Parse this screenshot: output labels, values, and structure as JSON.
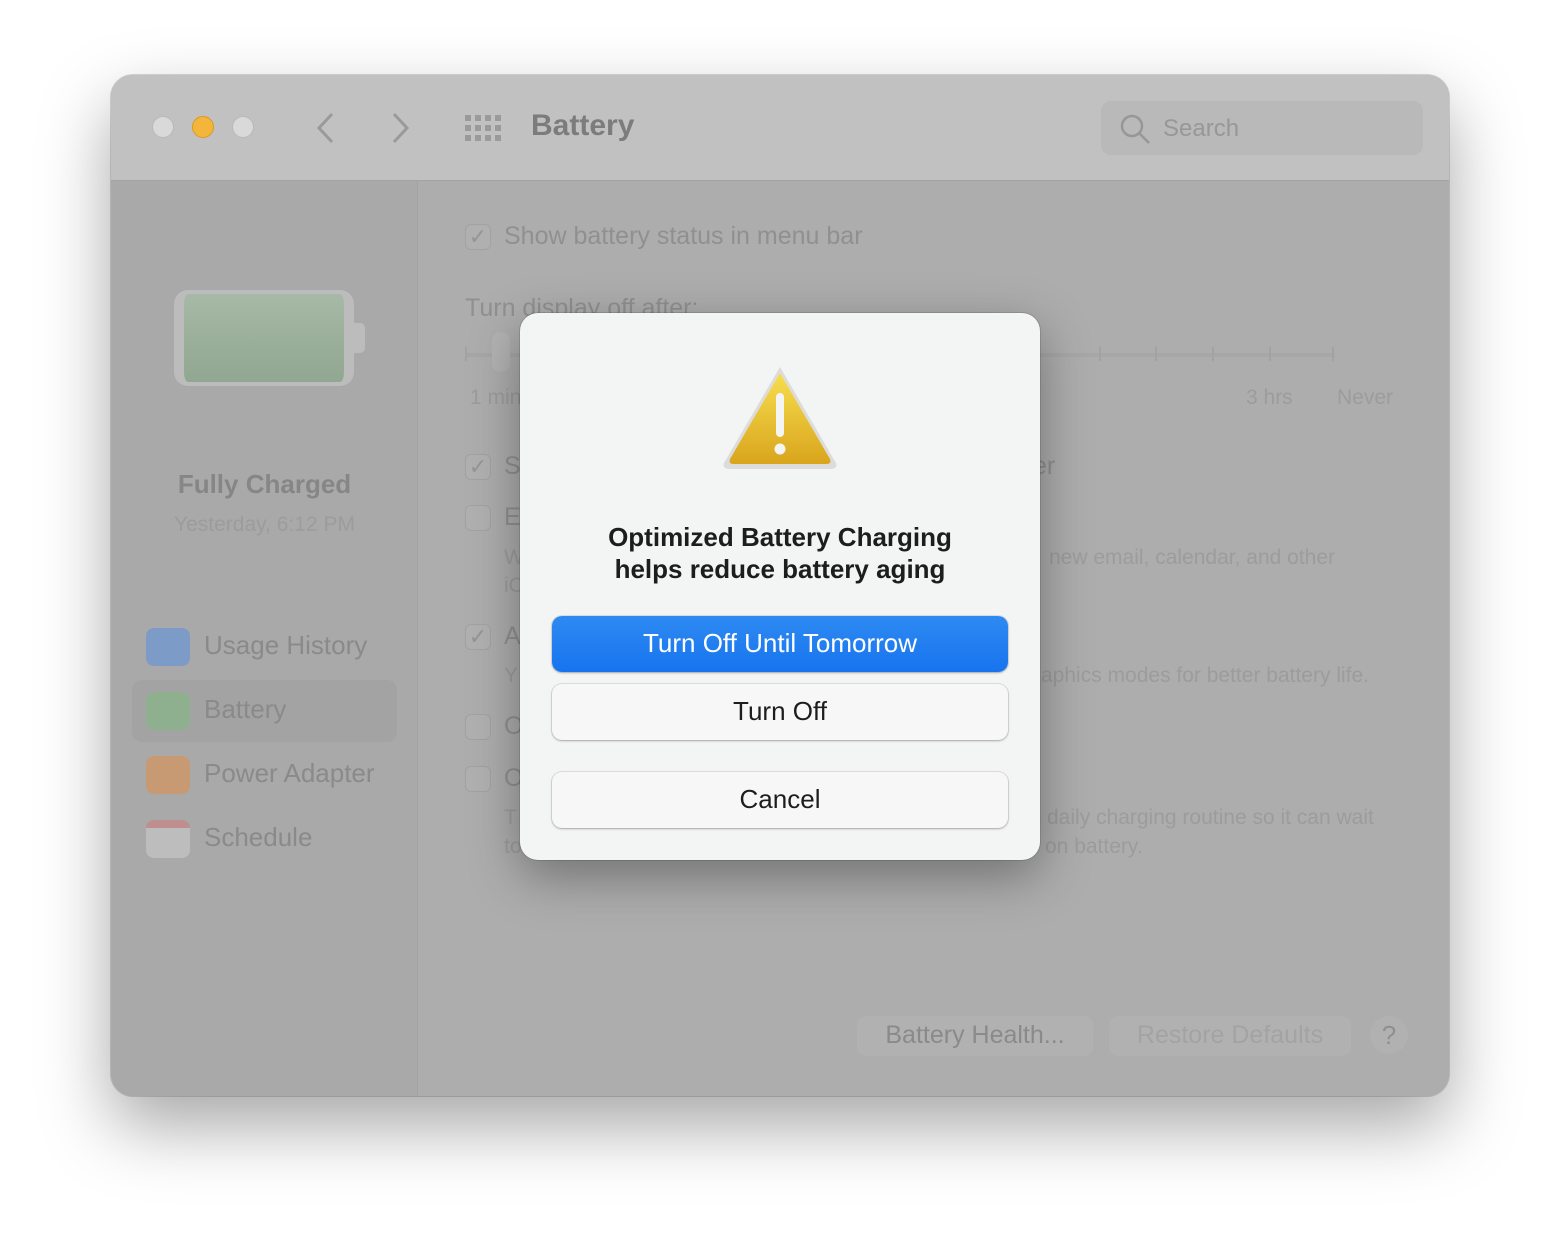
{
  "window": {
    "title": "Battery",
    "search_placeholder": "Search",
    "nav_back": "‹",
    "nav_forward": "›"
  },
  "sidebar": {
    "status": "Fully Charged",
    "status_time": "Yesterday, 6:12 PM",
    "battery_level_percent": 100,
    "items": [
      {
        "label": "Usage History",
        "icon": "bar-chart-icon",
        "color": "#7d9bc7"
      },
      {
        "label": "Battery",
        "icon": "battery-icon",
        "color": "#8fb08f",
        "selected": true
      },
      {
        "label": "Power Adapter",
        "icon": "lightning-icon",
        "color": "#c79a74"
      },
      {
        "label": "Schedule",
        "icon": "calendar-icon",
        "color": "#bdbdbd"
      }
    ]
  },
  "main": {
    "show_status": {
      "label": "Show battery status in menu bar",
      "checked": true
    },
    "display_off": {
      "label": "Turn display off after:",
      "ticks": [
        "1 min",
        "3 hrs",
        "Never"
      ]
    },
    "fragments": [
      "S",
      "er",
      "E",
      "W",
      "new email, calendar, and other",
      "iC",
      "A",
      "Y",
      "aphics modes for better battery life.",
      "O",
      "O",
      "T",
      "daily charging routine so it can wait",
      "to",
      "on battery."
    ],
    "battery_health_button": "Battery Health...",
    "restore_defaults_button": "Restore Defaults",
    "help_button": "?"
  },
  "dialog": {
    "icon": "warning-icon",
    "message_line1": "Optimized Battery Charging",
    "message_line2": "helps reduce battery aging",
    "primary_button": "Turn Off Until Tomorrow",
    "turn_off_button": "Turn Off",
    "cancel_button": "Cancel",
    "accent": "#1a78ef"
  }
}
